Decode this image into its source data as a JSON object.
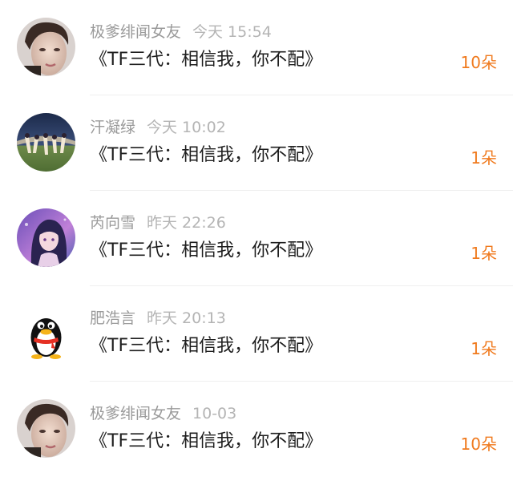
{
  "items": [
    {
      "user": "极爹绯闻女友",
      "time": "今天 15:54",
      "title": "《TF三代：相信我，你不配》",
      "count": "10朵",
      "avatar": "portrait-avatar"
    },
    {
      "user": "汗凝绿",
      "time": "今天 10:02",
      "title": "《TF三代：相信我，你不配》",
      "count": "1朵",
      "avatar": "group-photo-avatar"
    },
    {
      "user": "芮向雪",
      "time": "昨天 22:26",
      "title": "《TF三代：相信我，你不配》",
      "count": "1朵",
      "avatar": "anime-girl-avatar"
    },
    {
      "user": "肥浩言",
      "time": "昨天 20:13",
      "title": "《TF三代：相信我，你不配》",
      "count": "1朵",
      "avatar": "qq-penguin-avatar"
    },
    {
      "user": "极爹绯闻女友",
      "time": "10-03",
      "title": "《TF三代：相信我，你不配》",
      "count": "10朵",
      "avatar": "portrait-avatar"
    }
  ],
  "colors": {
    "accent": "#f07a1e",
    "meta": "#9a9a9a",
    "divider": "#efefef"
  }
}
